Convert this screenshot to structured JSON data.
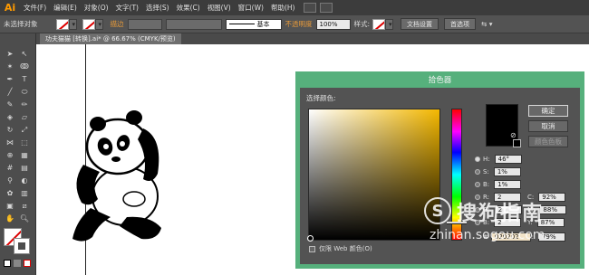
{
  "app": {
    "logo": "Ai"
  },
  "menu": [
    "文件(F)",
    "编辑(E)",
    "对象(O)",
    "文字(T)",
    "选择(S)",
    "效果(C)",
    "视图(V)",
    "窗口(W)",
    "帮助(H)"
  ],
  "control": {
    "no_selection": "未选择对象",
    "stroke_label": "描边",
    "stroke_style": "基本",
    "opacity_label": "不透明度",
    "opacity_value": "100%",
    "style_label": "样式:",
    "doc_setup": "文档设置",
    "preferences": "首选项"
  },
  "document_tab": {
    "title": "功夫猫猫 [转换].ai* @ 66.67% (CMYK/预览)"
  },
  "color_picker": {
    "title": "拾色器",
    "select_color_label": "选择颜色:",
    "ok_label": "确定",
    "cancel_label": "取消",
    "swatches_label": "颜色色板",
    "hsb": [
      {
        "label": "H:",
        "value": "46°"
      },
      {
        "label": "S:",
        "value": "1%"
      },
      {
        "label": "B:",
        "value": "1%"
      }
    ],
    "rgb": [
      {
        "label": "R:",
        "value": "2"
      },
      {
        "label": "G:",
        "value": "2"
      },
      {
        "label": "B:",
        "value": "2"
      }
    ],
    "cmyk": [
      {
        "label": "C:",
        "value": "92%"
      },
      {
        "label": "M:",
        "value": "88%"
      },
      {
        "label": "Y:",
        "value": "87%"
      },
      {
        "label": "K:",
        "value": "79%"
      }
    ],
    "hex_label": "#",
    "hex_value": "020202",
    "web_only_label": "仅限 Web 颜色(O)",
    "selected_color": "#020202",
    "hue_fraction": 0.87
  },
  "watermark": {
    "brand": "搜狗指南",
    "logo": "S",
    "url": "zhinan.sogou.com"
  }
}
